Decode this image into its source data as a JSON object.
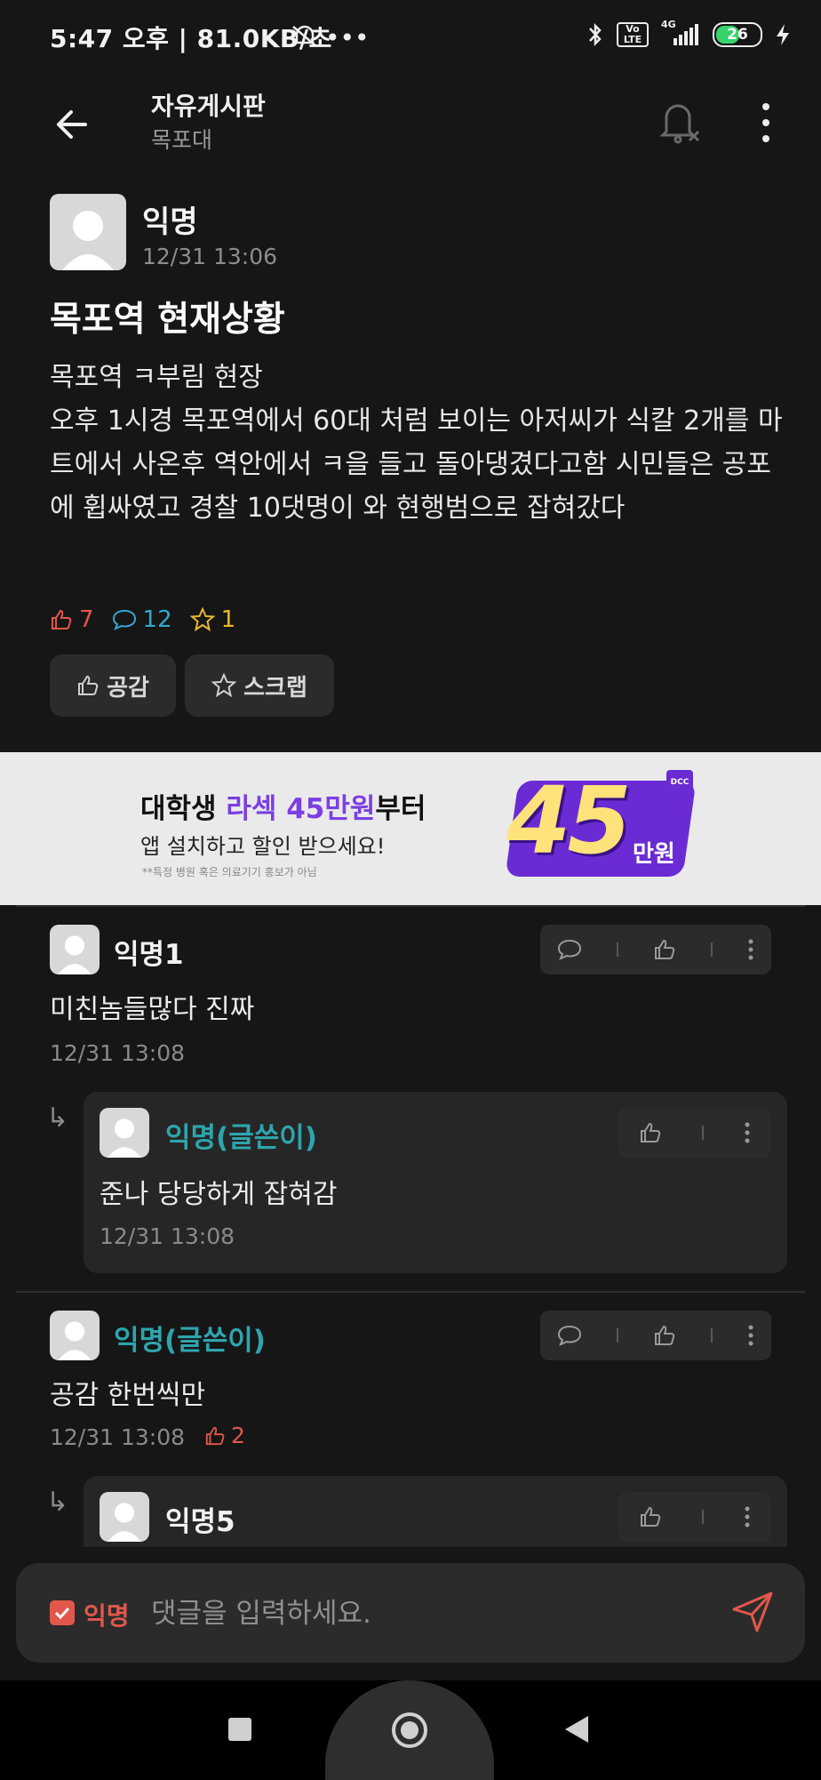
{
  "status_bar": {
    "time_info": "5:47 오후 | 81.0KB/초",
    "volte": "Vo LTE",
    "network": "4G",
    "battery": "26"
  },
  "header": {
    "title": "자유게시판",
    "subtitle": "목포대"
  },
  "post": {
    "author": "익명",
    "time": "12/31 13:06",
    "title": "목포역 현재상황",
    "body": "목포역 ㅋ부림 현장\n오후 1시경 목포역에서 60대 처럼 보이는 아저씨가 식칼 2개를 마트에서 사온후 역안에서 ㅋ을 들고 돌아댕겼다고함 시민들은 공포에 휩싸였고 경찰 10댓명이 와 현행범으로 잡혀갔다",
    "likes": "7",
    "comments": "12",
    "scraps": "1",
    "like_button": "공감",
    "scrap_button": "스크랩"
  },
  "ad": {
    "title_prefix": "대학생 ",
    "title_highlight": "라섹 45만원",
    "title_suffix": "부터",
    "subtitle": "앱 설치하고 할인 받으세요!",
    "note": "**특정 병원 혹은 의료기기 홍보가 아님",
    "big_number": "45",
    "big_unit": "만원",
    "badge": "DCC"
  },
  "comments": [
    {
      "author": "익명1",
      "text": "미친놈들많다 진짜",
      "time": "12/31 13:08"
    },
    {
      "author": "익명(글쓴이)",
      "text": "준나 당당하게 잡혀감",
      "time": "12/31 13:08"
    },
    {
      "author": "익명(글쓴이)",
      "text": "공감 한번씩만",
      "time": "12/31 13:08",
      "likes": "2"
    },
    {
      "author": "익명5"
    }
  ],
  "composer": {
    "anonymous_label": "익명",
    "placeholder": "댓글을 입력하세요."
  },
  "colors": {
    "background": "#161616",
    "like_red": "#e2574c",
    "comment_blue": "#33a8cf",
    "scrap_yellow": "#e8b830",
    "op_teal": "#2ea5ad",
    "ad_purple": "#7b3fe4"
  }
}
